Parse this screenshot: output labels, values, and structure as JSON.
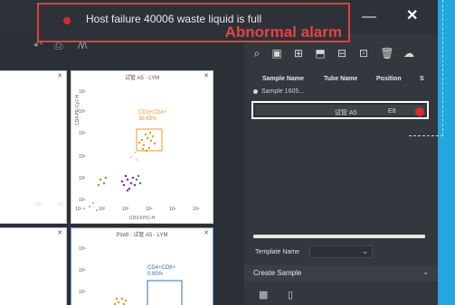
{
  "window": {
    "minimize_icon": "minimize-icon",
    "close_icon": "close-icon",
    "minimize_glyph": "—",
    "close_glyph": "✕"
  },
  "alarm": {
    "message": "Host failure 40006 waste liquid is full",
    "title": "Abnormal alarm",
    "indicator_color": "#d42c2c"
  },
  "left_toolbar": {
    "icons": [
      "undo-icon",
      "print-icon",
      "layout-icon"
    ],
    "glyphs": [
      "↶",
      "⎙",
      "/\\/\\"
    ]
  },
  "plots": [
    {
      "title": "试管 A5 - LYM",
      "gate_label": "CD3+CD4+",
      "gate_pct": "38.69%",
      "x_axis": "CD3-FITC-H",
      "y_axis": "CD4-PE-Cy7-H",
      "x_ticks": [
        "10¹",
        "10²",
        "10³",
        "10⁴",
        "10⁵",
        "10⁶"
      ],
      "y_ticks": [
        "10⁶",
        "10⁵",
        "10⁴",
        "10³",
        "10²",
        "10¹"
      ]
    },
    {
      "title": "Plot8 : 试管 A5 - LYM",
      "gate_label": "CD4+CD8+",
      "gate_pct": "0.85%",
      "y_ticks": [
        "10⁶",
        "10⁵",
        "10⁴"
      ]
    }
  ],
  "left_plot_ticks": [
    "10⁵",
    "10⁶"
  ],
  "right_toolbar": {
    "icons": [
      "search-icon",
      "save-icon",
      "import-icon",
      "export-icon",
      "report-icon",
      "copy-icon",
      "delete-icon",
      "cloud-icon"
    ],
    "glyphs": [
      "⌕",
      "▣",
      "⊞",
      "⬒",
      "⊟",
      "⊡",
      "🗑",
      "☁"
    ]
  },
  "table": {
    "headers": [
      "Sample Name",
      "Tube Name",
      "Position",
      "S"
    ],
    "sample": "Sample 1605...",
    "tube": {
      "name": "试管 A5",
      "position": "E8",
      "status_color": "#d32d2d"
    }
  },
  "template": {
    "label": "Template Name",
    "value": "",
    "chevron": "⌄"
  },
  "create_sample": {
    "label": "Create Sample",
    "chevron": "⌄"
  },
  "bottom_icons": [
    "plate-icon",
    "tube-icon"
  ],
  "bottom_glyphs": [
    "▦",
    "▯"
  ]
}
